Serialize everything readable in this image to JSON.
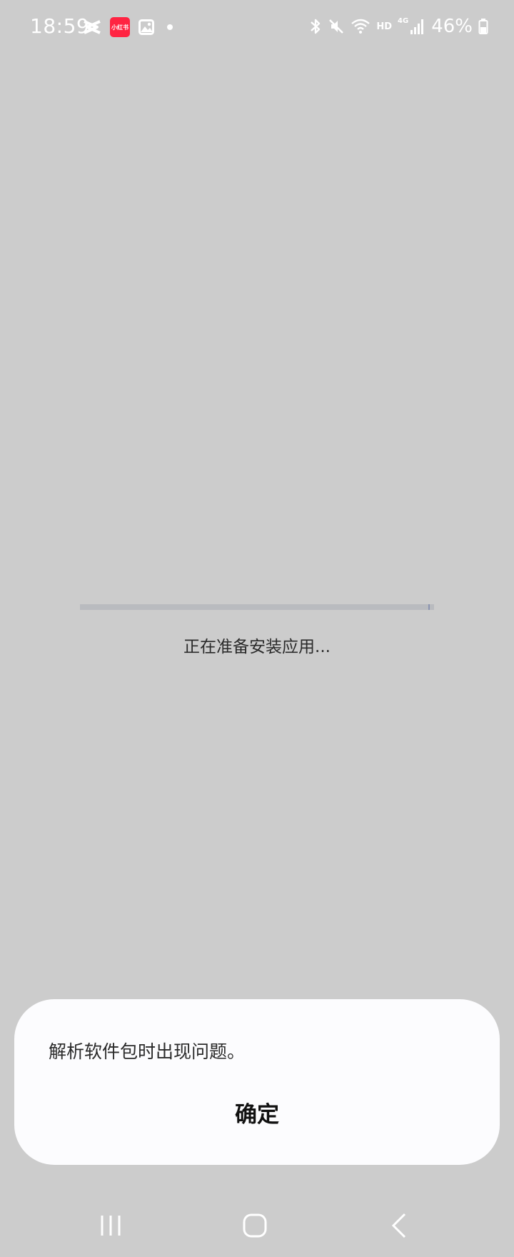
{
  "status_bar": {
    "time": "18:59",
    "notification_icons": [
      "capcut-icon",
      "xiaohongshu-icon",
      "gallery-icon",
      "notification-dot"
    ],
    "app_badge_text": "小红书",
    "hd": "HD",
    "network": "4G",
    "battery_percent": "46%",
    "system_icons": [
      "bluetooth-icon",
      "mute-icon",
      "wifi-icon",
      "signal-icon",
      "battery-icon"
    ]
  },
  "installer": {
    "progress_fraction": 0.0,
    "status_text": "正在准备安装应用..."
  },
  "dialog": {
    "message": "解析软件包时出现问题。",
    "confirm_label": "确定"
  },
  "nav_bar": {
    "buttons": [
      "recents-icon",
      "home-icon",
      "back-icon"
    ]
  },
  "colors": {
    "background": "#cccccc",
    "dialog_background": "#fcfcfe",
    "badge_red": "#ff2442",
    "progress_track": "#b9bbbf",
    "progress_fill": "#7d87a8"
  }
}
